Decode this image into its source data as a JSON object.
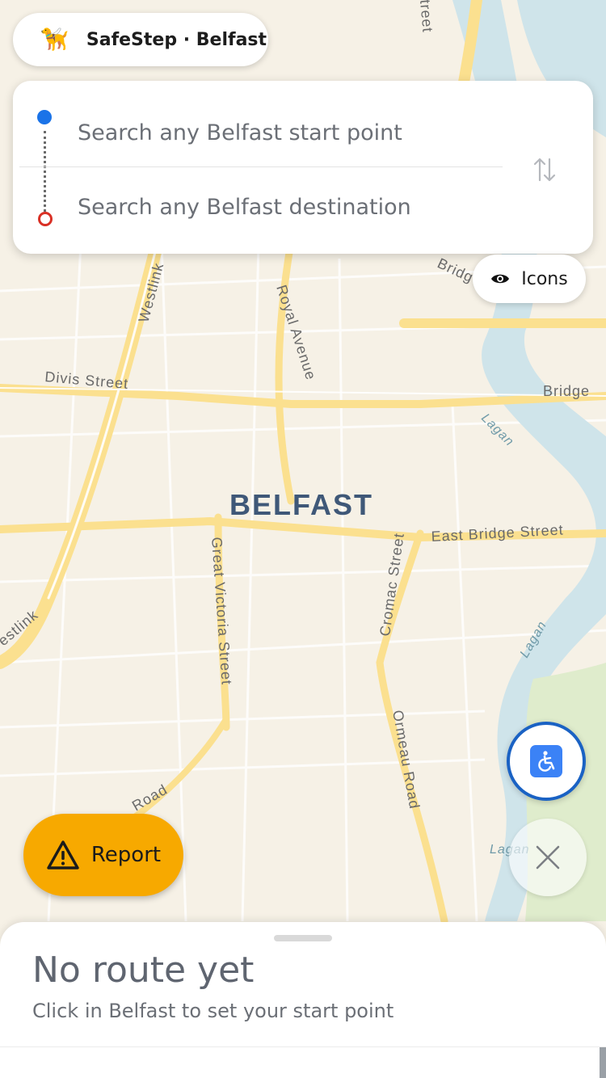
{
  "app": {
    "title": "SafeStep · Belfast",
    "logo_icon": "🦮"
  },
  "search": {
    "start_placeholder": "Search any Belfast start point",
    "end_placeholder": "Search any Belfast destination"
  },
  "map": {
    "city_label": "BELFAST",
    "street_labels": [
      "Royal Avenue",
      "Divis Street",
      "Westlink",
      "Great Victoria Street",
      "Cromac Street",
      "East Bridge Street",
      "Ormeau Road",
      "Bridge",
      "Lagan",
      "Lagan",
      "Lagan",
      "estlink",
      "Road",
      "treet",
      "Bridg"
    ]
  },
  "icons_toggle": {
    "label": "Icons"
  },
  "report": {
    "label": "Report"
  },
  "sheet": {
    "title": "No route yet",
    "subtitle": "Click in Belfast to set your start point"
  },
  "colors": {
    "accent": "#1a73e8",
    "report": "#f7a900",
    "end_marker": "#d93025"
  }
}
